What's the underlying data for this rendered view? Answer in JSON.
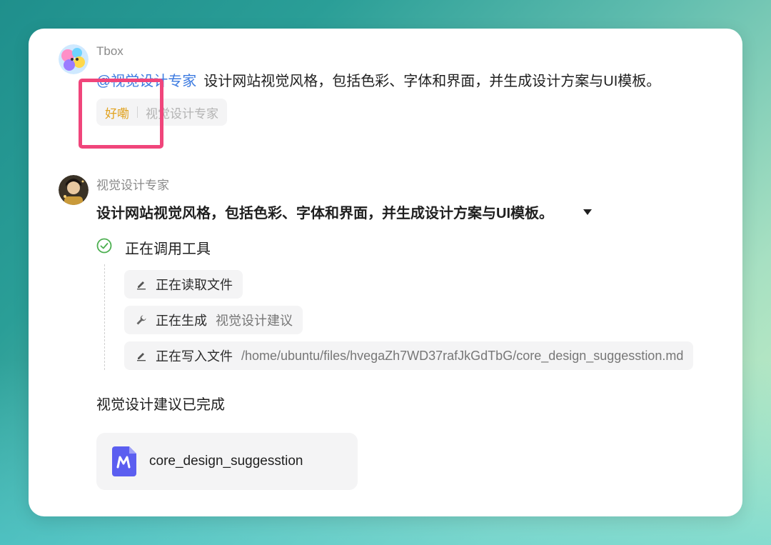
{
  "user": {
    "name": "Tbox",
    "mention": "@视觉设计专家",
    "message": "设计网站视觉风格，包括色彩、字体和界面，并生成设计方案与UI模板。"
  },
  "ack": {
    "label": "好嘞",
    "agent": "视觉设计专家"
  },
  "agent": {
    "name": "视觉设计专家",
    "task_title": "设计网站视觉风格，包括色彩、字体和界面，并生成设计方案与UI模板。",
    "status": "正在调用工具",
    "tools": [
      {
        "icon": "pencil-icon",
        "label": "正在读取文件",
        "detail": ""
      },
      {
        "icon": "wrench-icon",
        "label": "正在生成",
        "detail": "视觉设计建议"
      },
      {
        "icon": "pencil-icon",
        "label": "正在写入文件",
        "detail": "/home/ubuntu/files/hvegaZh7WD37rafJkGdTbG/core_design_suggesstion.md"
      }
    ],
    "done_text": "视觉设计建议已完成",
    "file": {
      "name": "core_design_suggesstion",
      "icon": "markdown-file-icon"
    }
  },
  "colors": {
    "mention": "#3d7be0",
    "ack": "#e1a21e",
    "highlight": "#f0457b",
    "check": "#4caf50",
    "file_icon": "#5b5ef0"
  }
}
